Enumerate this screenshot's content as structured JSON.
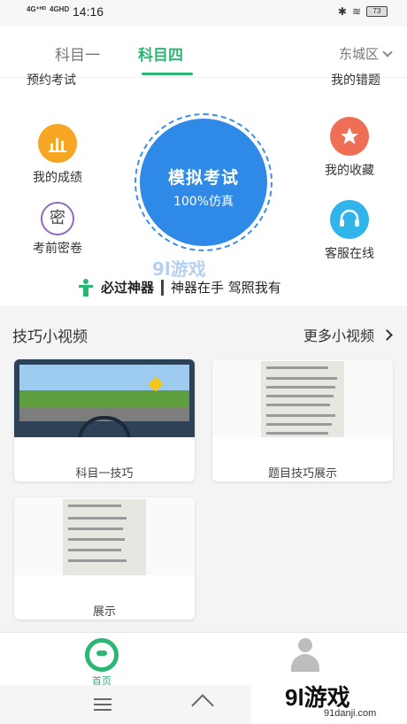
{
  "status_bar": {
    "network_1": "4G⁺ᴴᴰ",
    "network_2": "4GHD",
    "time": "14:16",
    "battery": "73"
  },
  "header": {
    "tabs": [
      {
        "label": "科目一",
        "active": false
      },
      {
        "label": "科目四",
        "active": true
      }
    ],
    "city": "东城区"
  },
  "functions": {
    "cutoff_left": "预约考试",
    "cutoff_right": "我的错题",
    "score": "我的成绩",
    "favorites": "我的收藏",
    "secret": "考前密卷",
    "secret_glyph": "密",
    "service": "客服在线",
    "exam_title": "模拟考试",
    "exam_subtitle": "100%仿真"
  },
  "slogan": {
    "bold": "必过神器",
    "rest": "神器在手  驾照我有"
  },
  "watermark_center": "9l游戏",
  "videos": {
    "title": "技巧小视频",
    "more": "更多小视频",
    "items": [
      {
        "caption": "科目一技巧"
      },
      {
        "caption": "题目技巧展示"
      },
      {
        "caption": "展示"
      }
    ]
  },
  "bottom_nav": {
    "home": "首页",
    "me": "我的"
  },
  "watermark": {
    "main": "9l游戏",
    "sub": "91danji.com"
  },
  "colors": {
    "accent": "#2bb673",
    "exam_blue": "#2e8ae6",
    "score_orange": "#f6a623",
    "fav_red": "#ee6f56",
    "service_blue": "#31b4ea"
  }
}
